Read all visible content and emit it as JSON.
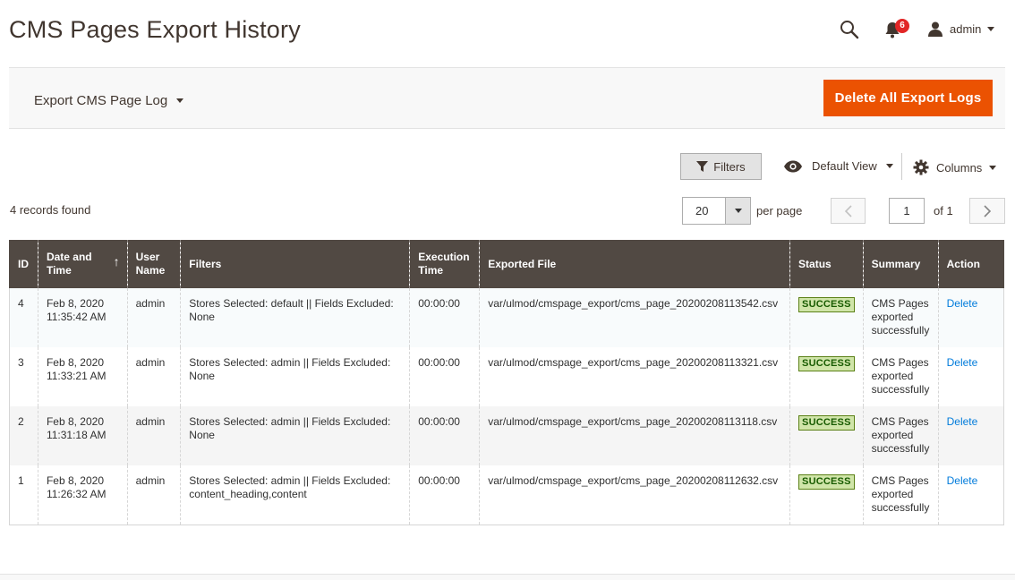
{
  "page": {
    "title": "CMS Pages Export History"
  },
  "header": {
    "notification_count": "6",
    "user_name": "admin"
  },
  "action_bar": {
    "export_switch_label": "Export CMS Page Log",
    "delete_all_label": "Delete All Export Logs"
  },
  "grid_controls": {
    "filters_label": "Filters",
    "view_label": "Default View",
    "columns_label": "Columns",
    "records_found": "4 records found",
    "per_page_value": "20",
    "per_page_label": "per page",
    "current_page": "1",
    "of_pages": "of 1"
  },
  "table": {
    "columns": [
      "ID",
      "Date and Time",
      "User Name",
      "Filters",
      "Execution Time",
      "Exported File",
      "Status",
      "Summary",
      "Action"
    ],
    "rows": [
      {
        "id": "4",
        "datetime": "Feb 8, 2020 11:35:42 AM",
        "user": "admin",
        "filters": "Stores Selected: default || Fields Excluded: None",
        "exec_time": "00:00:00",
        "file": "var/ulmod/cmspage_export/cms_page_20200208113542.csv",
        "status": "SUCCESS",
        "summary": "CMS Pages exported successfully",
        "action": "Delete"
      },
      {
        "id": "3",
        "datetime": "Feb 8, 2020 11:33:21 AM",
        "user": "admin",
        "filters": "Stores Selected: admin || Fields Excluded: None",
        "exec_time": "00:00:00",
        "file": "var/ulmod/cmspage_export/cms_page_20200208113321.csv",
        "status": "SUCCESS",
        "summary": "CMS Pages exported successfully",
        "action": "Delete"
      },
      {
        "id": "2",
        "datetime": "Feb 8, 2020 11:31:18 AM",
        "user": "admin",
        "filters": "Stores Selected: admin || Fields Excluded: None",
        "exec_time": "00:00:00",
        "file": "var/ulmod/cmspage_export/cms_page_20200208113118.csv",
        "status": "SUCCESS",
        "summary": "CMS Pages exported successfully",
        "action": "Delete"
      },
      {
        "id": "1",
        "datetime": "Feb 8, 2020 11:26:32 AM",
        "user": "admin",
        "filters": "Stores Selected: admin || Fields Excluded: content_heading,content",
        "exec_time": "00:00:00",
        "file": "var/ulmod/cmspage_export/cms_page_20200208112632.csv",
        "status": "SUCCESS",
        "summary": "CMS Pages exported successfully",
        "action": "Delete"
      }
    ]
  },
  "colors": {
    "accent": "#eb5202",
    "header_bg": "#514943",
    "link": "#007bdb",
    "success_bg": "#d0e5a9",
    "badge_red": "#e22626"
  },
  "icons": {
    "search": "search-icon",
    "bell": "bell-icon",
    "user": "user-icon",
    "filter": "filter-icon",
    "eye": "eye-icon",
    "gear": "gear-icon"
  }
}
